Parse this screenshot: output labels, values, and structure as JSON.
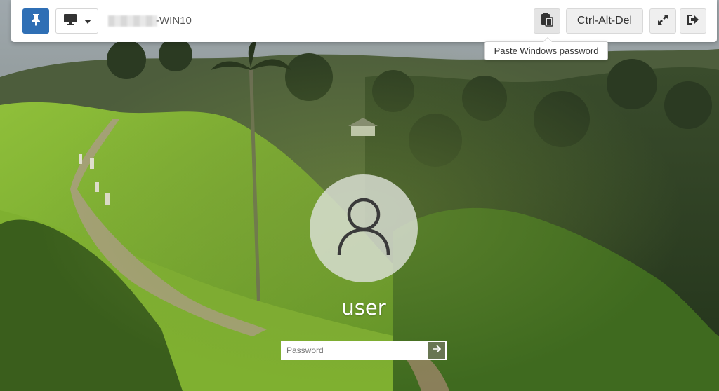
{
  "toolbar": {
    "pin_icon": "pin-icon",
    "display_icon": "monitor-icon",
    "host_name": "-WIN10",
    "paste_icon": "clipboard-paste-icon",
    "cad_label": "Ctrl-Alt-Del",
    "fullscreen_icon": "expand-icon",
    "logout_icon": "sign-out-icon",
    "accent_color": "#2f6fb5"
  },
  "tooltip": {
    "text": "Paste Windows password"
  },
  "login": {
    "avatar_icon": "user-icon",
    "username": "user",
    "password_placeholder": "Password",
    "password_value": "",
    "submit_icon": "arrow-right-icon"
  }
}
